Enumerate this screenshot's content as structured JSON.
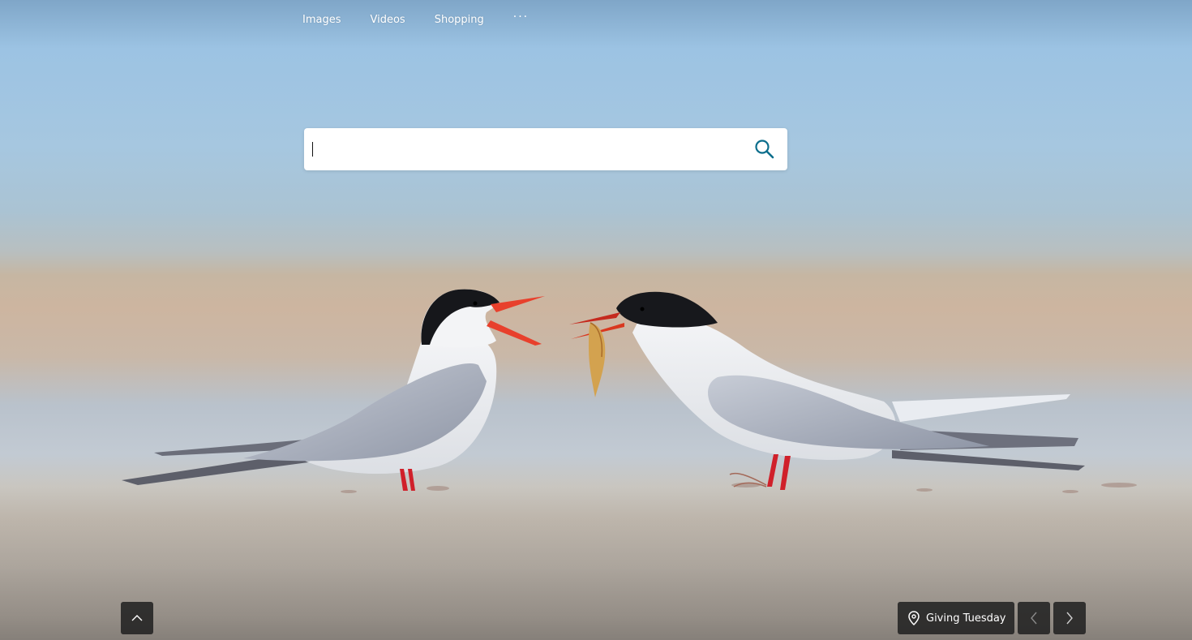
{
  "nav": {
    "items": [
      {
        "label": "Images"
      },
      {
        "label": "Videos"
      },
      {
        "label": "Shopping"
      }
    ],
    "more_label": "···"
  },
  "search": {
    "value": "",
    "placeholder": "",
    "icon": "search-icon",
    "accent": "#0c6e8c"
  },
  "background": {
    "subject": "two terns on beach, one holding fish"
  },
  "footer": {
    "scroll_icon": "chevron-up-icon",
    "location_icon": "location-pin-icon",
    "location_label": "Giving Tuesday",
    "prev_icon": "chevron-left-icon",
    "next_icon": "chevron-right-icon"
  },
  "colors": {
    "button_bg": "#222222",
    "text_on_dark": "#ffffff"
  }
}
